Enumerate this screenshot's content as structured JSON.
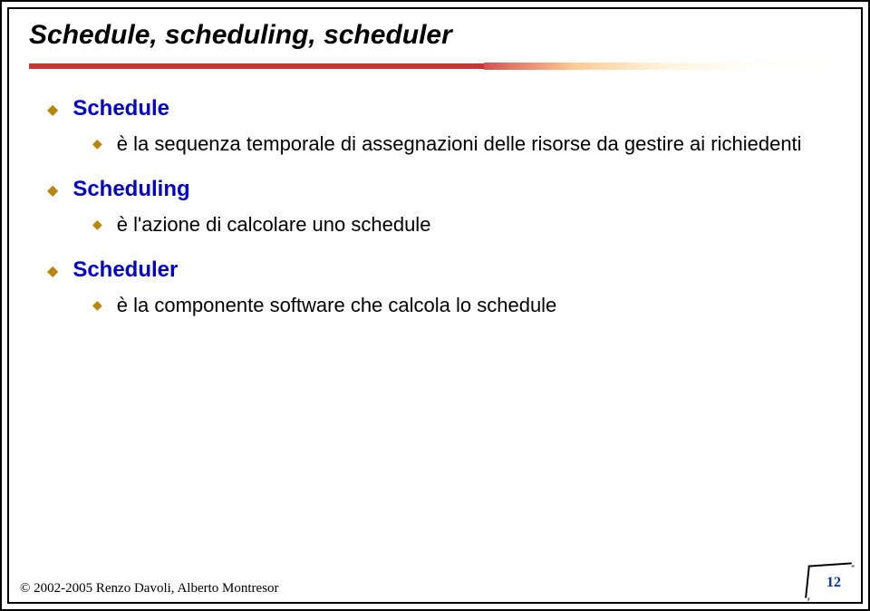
{
  "title": "Schedule, scheduling, scheduler",
  "sections": [
    {
      "heading": "Schedule",
      "sub": "è la sequenza temporale di assegnazioni delle risorse da gestire ai richiedenti"
    },
    {
      "heading": "Scheduling",
      "sub": "è l'azione di calcolare uno schedule"
    },
    {
      "heading": "Scheduler",
      "sub": "è la componente software che calcola lo schedule"
    }
  ],
  "footer": {
    "copyright": "© 2002-2005 Renzo Davoli, Alberto Montresor",
    "page": "12"
  }
}
